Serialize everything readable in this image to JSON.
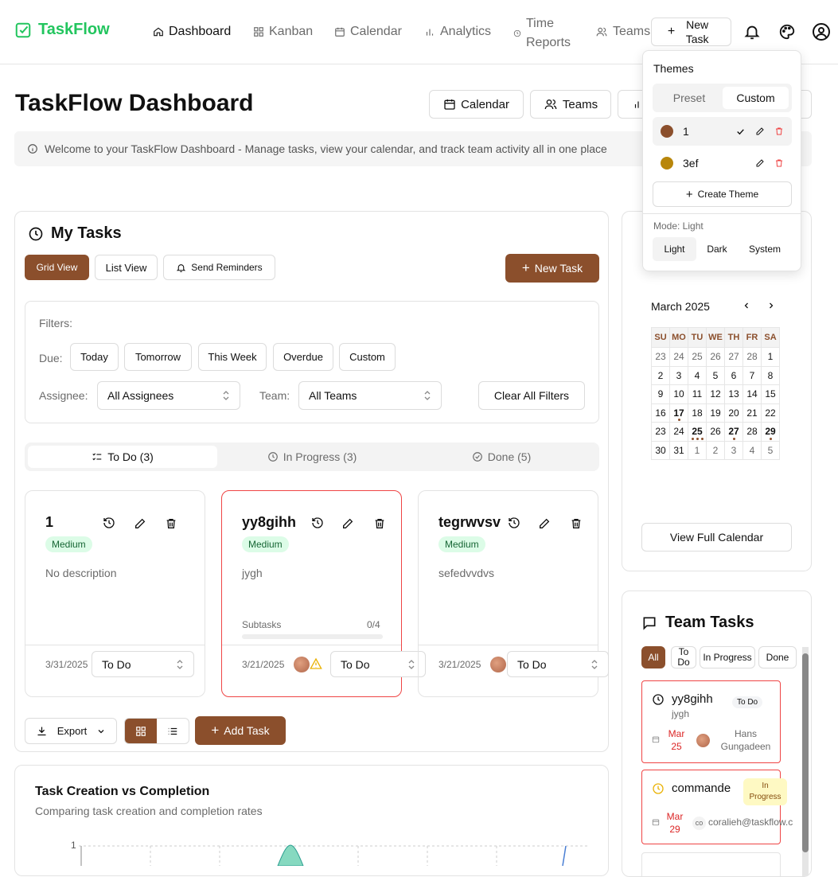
{
  "app": {
    "name": "TaskFlow"
  },
  "nav": {
    "items": [
      {
        "label": "Dashboard",
        "icon": "home-icon"
      },
      {
        "label": "Kanban",
        "icon": "grid-icon"
      },
      {
        "label": "Calendar",
        "icon": "calendar-icon"
      },
      {
        "label": "Analytics",
        "icon": "bar-chart-icon"
      },
      {
        "label": "Time Reports",
        "icon": "clock-icon"
      },
      {
        "label": "Teams",
        "icon": "users-icon"
      }
    ],
    "new_task": "New Task"
  },
  "page": {
    "title": "TaskFlow Dashboard",
    "actions": [
      "Calendar",
      "Teams"
    ],
    "banner": "Welcome to your TaskFlow Dashboard - Manage tasks, view your calendar, and track team activity all in one place"
  },
  "themes": {
    "title": "Themes",
    "tabs": [
      "Preset",
      "Custom"
    ],
    "items": [
      {
        "name": "1",
        "color": "#8b4f2c"
      },
      {
        "name": "3ef",
        "color": "#b8860b"
      }
    ],
    "create": "Create Theme",
    "mode_label": "Mode: Light",
    "modes": [
      "Light",
      "Dark",
      "System"
    ]
  },
  "mytasks": {
    "title": "My Tasks",
    "views": [
      "Grid View",
      "List View"
    ],
    "reminders": "Send Reminders",
    "new_task": "New Task",
    "filters": {
      "label": "Filters:",
      "due_label": "Due:",
      "due": [
        "Today",
        "Tomorrow",
        "This Week",
        "Overdue",
        "Custom"
      ],
      "assignee_label": "Assignee:",
      "assignee": "All Assignees",
      "team_label": "Team:",
      "team": "All Teams",
      "clear": "Clear All Filters"
    },
    "tabs": [
      "To Do (3)",
      "In Progress (3)",
      "Done (5)"
    ],
    "cards": [
      {
        "title": "1",
        "priority": "Medium",
        "desc": "No description",
        "date": "3/31/2025",
        "status": "To Do"
      },
      {
        "title": "yy8gihh",
        "priority": "Medium",
        "desc": "jygh",
        "subtasks_label": "Subtasks",
        "subtasks": "0/4",
        "date": "3/21/2025",
        "status": "To Do"
      },
      {
        "title": "tegrwvsv",
        "priority": "Medium",
        "desc": "sefedvvdvs",
        "date": "3/21/2025",
        "status": "To Do"
      }
    ],
    "export": "Export",
    "add_task": "Add Task"
  },
  "chart": {
    "title": "Task Creation vs Completion",
    "subtitle": "Comparing task creation and completion rates",
    "ytick": "1"
  },
  "calendar": {
    "month": "March 2025",
    "days": [
      "SU",
      "MO",
      "TU",
      "WE",
      "TH",
      "FR",
      "SA"
    ],
    "weeks": [
      [
        "23",
        "24",
        "25",
        "26",
        "27",
        "28",
        "1"
      ],
      [
        "2",
        "3",
        "4",
        "5",
        "6",
        "7",
        "8"
      ],
      [
        "9",
        "10",
        "11",
        "12",
        "13",
        "14",
        "15"
      ],
      [
        "16",
        "17",
        "18",
        "19",
        "20",
        "21",
        "22"
      ],
      [
        "23",
        "24",
        "25",
        "26",
        "27",
        "28",
        "29"
      ],
      [
        "30",
        "31",
        "1",
        "2",
        "3",
        "4",
        "5"
      ]
    ],
    "view_full": "View Full Calendar"
  },
  "team": {
    "title": "Team Tasks",
    "filters": [
      "All",
      "To Do",
      "In Progress",
      "Done"
    ],
    "items": [
      {
        "title": "yy8gihh",
        "sub": "jygh",
        "status": "To Do",
        "date": "Mar 25",
        "assignee": "Hans Gungadeen"
      },
      {
        "title": "commande",
        "status": "In Progress",
        "date": "Mar 29",
        "initials": "co",
        "assignee": "coralieh@taskflow.c"
      }
    ]
  }
}
